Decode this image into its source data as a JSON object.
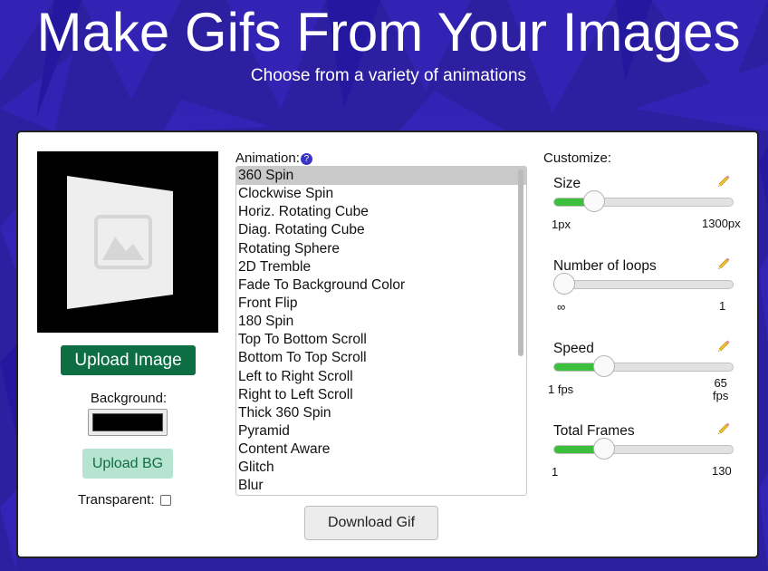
{
  "hero": {
    "title": "Make Gifs From Your Images",
    "subtitle": "Choose from a variety of animations"
  },
  "colors": {
    "background": "#2c1fa0",
    "primary_green": "#0e6e43",
    "light_green": "#b6e4d0",
    "slider_fill": "#3cbf3c",
    "help_icon": "#3b35c6"
  },
  "preview": {
    "icon": "image-placeholder-icon",
    "background": "#000000"
  },
  "upload_image_label": "Upload Image",
  "background_label": "Background:",
  "background_color": "#000000",
  "upload_bg_label": "Upload BG",
  "transparent_label": "Transparent:",
  "animation": {
    "label": "Animation:",
    "help_icon": "?",
    "selected": "360 Spin",
    "items": [
      "360 Spin",
      "Clockwise Spin",
      "Horiz. Rotating Cube",
      "Diag. Rotating Cube",
      "Rotating Sphere",
      "2D Tremble",
      "Fade To Background Color",
      "Front Flip",
      "180 Spin",
      "Top To Bottom Scroll",
      "Bottom To Top Scroll",
      "Left to Right Scroll",
      "Right to Left Scroll",
      "Thick 360 Spin",
      "Pyramid",
      "Content Aware",
      "Glitch",
      "Blur"
    ]
  },
  "download_label": "Download Gif",
  "customize": {
    "label": "Customize:",
    "controls": [
      {
        "key": "size",
        "name": "Size",
        "min_label": "1px",
        "max_label": "1300px",
        "value_fraction": 0.19
      },
      {
        "key": "loops",
        "name": "Number of loops",
        "min_label": "∞",
        "max_label": "1",
        "value_fraction": 0.0
      },
      {
        "key": "speed",
        "name": "Speed",
        "min_label": "1 fps",
        "max_label": "65\nfps",
        "value_fraction": 0.25
      },
      {
        "key": "frames",
        "name": "Total Frames",
        "min_label": "1",
        "max_label": "130",
        "value_fraction": 0.25
      }
    ]
  }
}
